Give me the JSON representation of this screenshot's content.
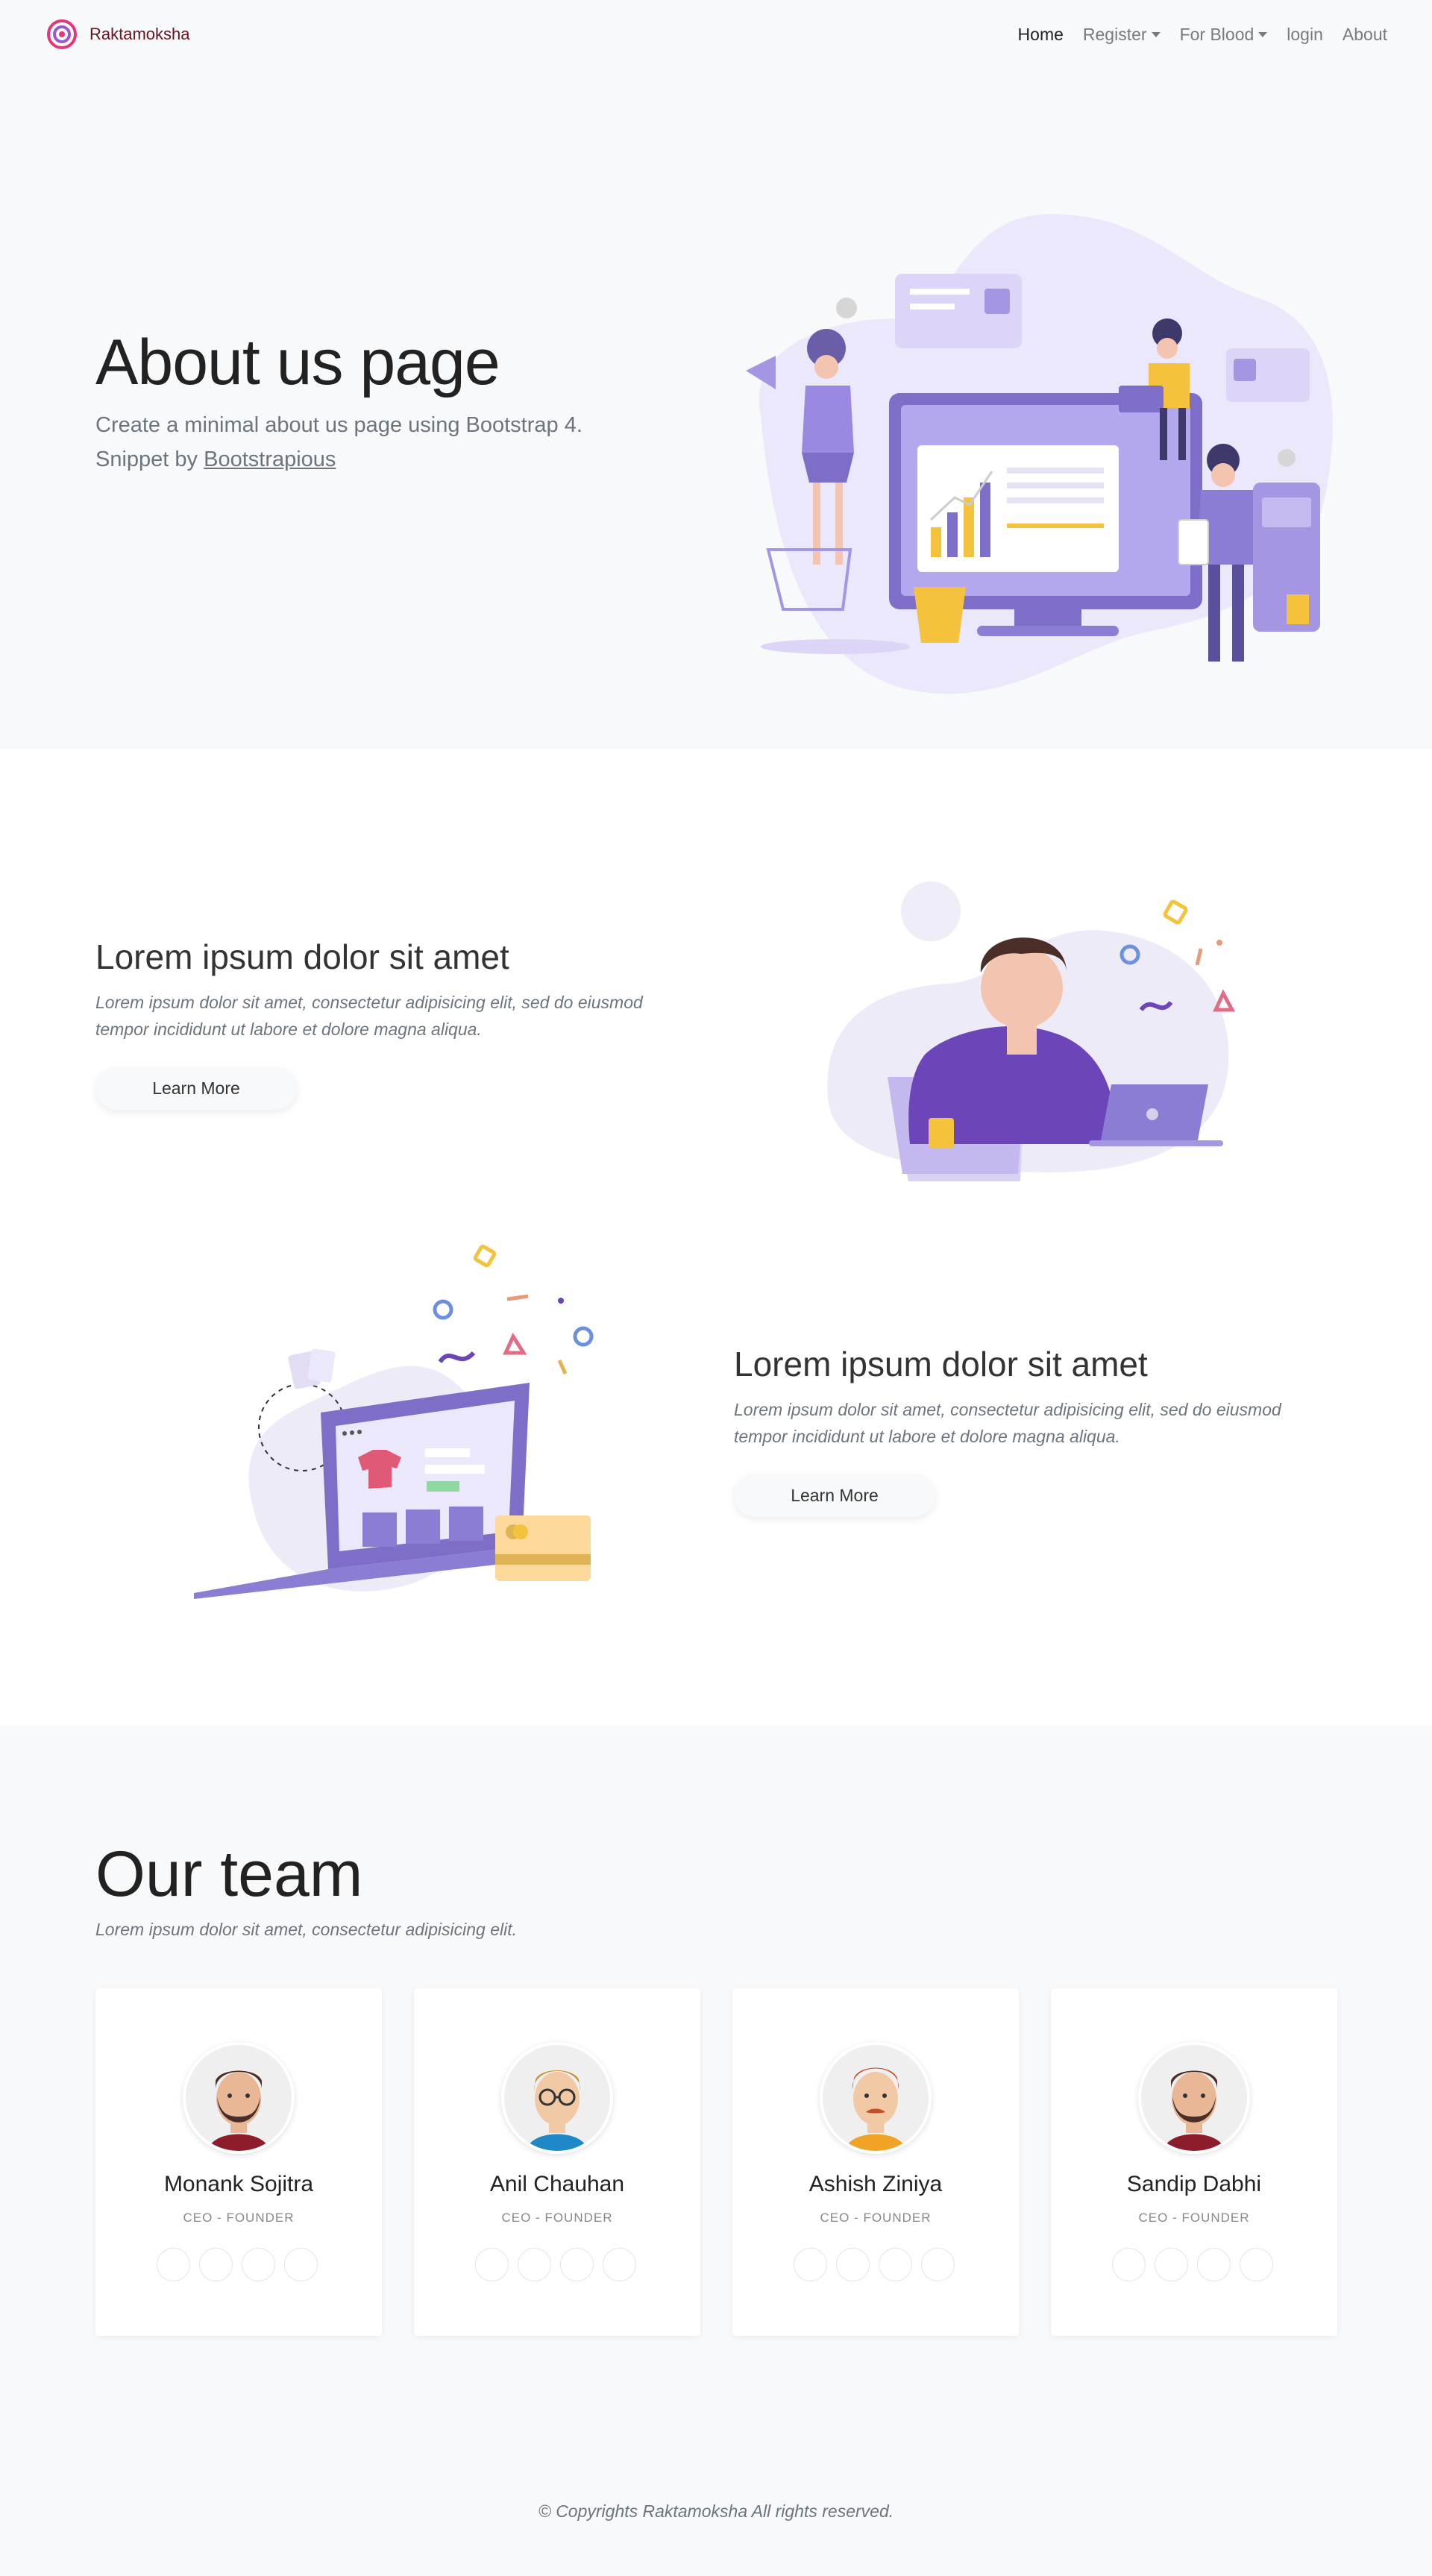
{
  "nav": {
    "brand": "Raktamoksha",
    "links": [
      {
        "label": "Home"
      },
      {
        "label": "Register"
      },
      {
        "label": "For Blood"
      },
      {
        "label": "login"
      },
      {
        "label": "About"
      }
    ]
  },
  "hero": {
    "title": "About us page",
    "subtitle": "Create a minimal about us page using Bootstrap 4.",
    "snippet_prefix": "Snippet by ",
    "snippet_link": "Bootstrapious"
  },
  "features": [
    {
      "title": "Lorem ipsum dolor sit amet",
      "text": "Lorem ipsum dolor sit amet, consectetur adipisicing elit, sed do eiusmod tempor incididunt ut labore et dolore magna aliqua.",
      "button": "Learn More"
    },
    {
      "title": "Lorem ipsum dolor sit amet",
      "text": "Lorem ipsum dolor sit amet, consectetur adipisicing elit, sed do eiusmod tempor incididunt ut labore et dolore magna aliqua.",
      "button": "Learn More"
    }
  ],
  "team": {
    "title": "Our team",
    "subtitle": "Lorem ipsum dolor sit amet, consectetur adipisicing elit.",
    "members": [
      {
        "name": "Monank Sojitra",
        "role": "CEO - FOUNDER"
      },
      {
        "name": "Anil Chauhan",
        "role": "CEO - FOUNDER"
      },
      {
        "name": "Ashish Ziniya",
        "role": "CEO - FOUNDER"
      },
      {
        "name": "Sandip Dabhi",
        "role": "CEO - FOUNDER"
      }
    ]
  },
  "footer": {
    "text": "© Copyrights Raktamoksha All rights reserved."
  },
  "colors": {
    "accent_purple": "#7e6ec7",
    "light_purple": "#ece8fb",
    "yellow": "#f4c23d",
    "brand_text": "#6b1222"
  }
}
